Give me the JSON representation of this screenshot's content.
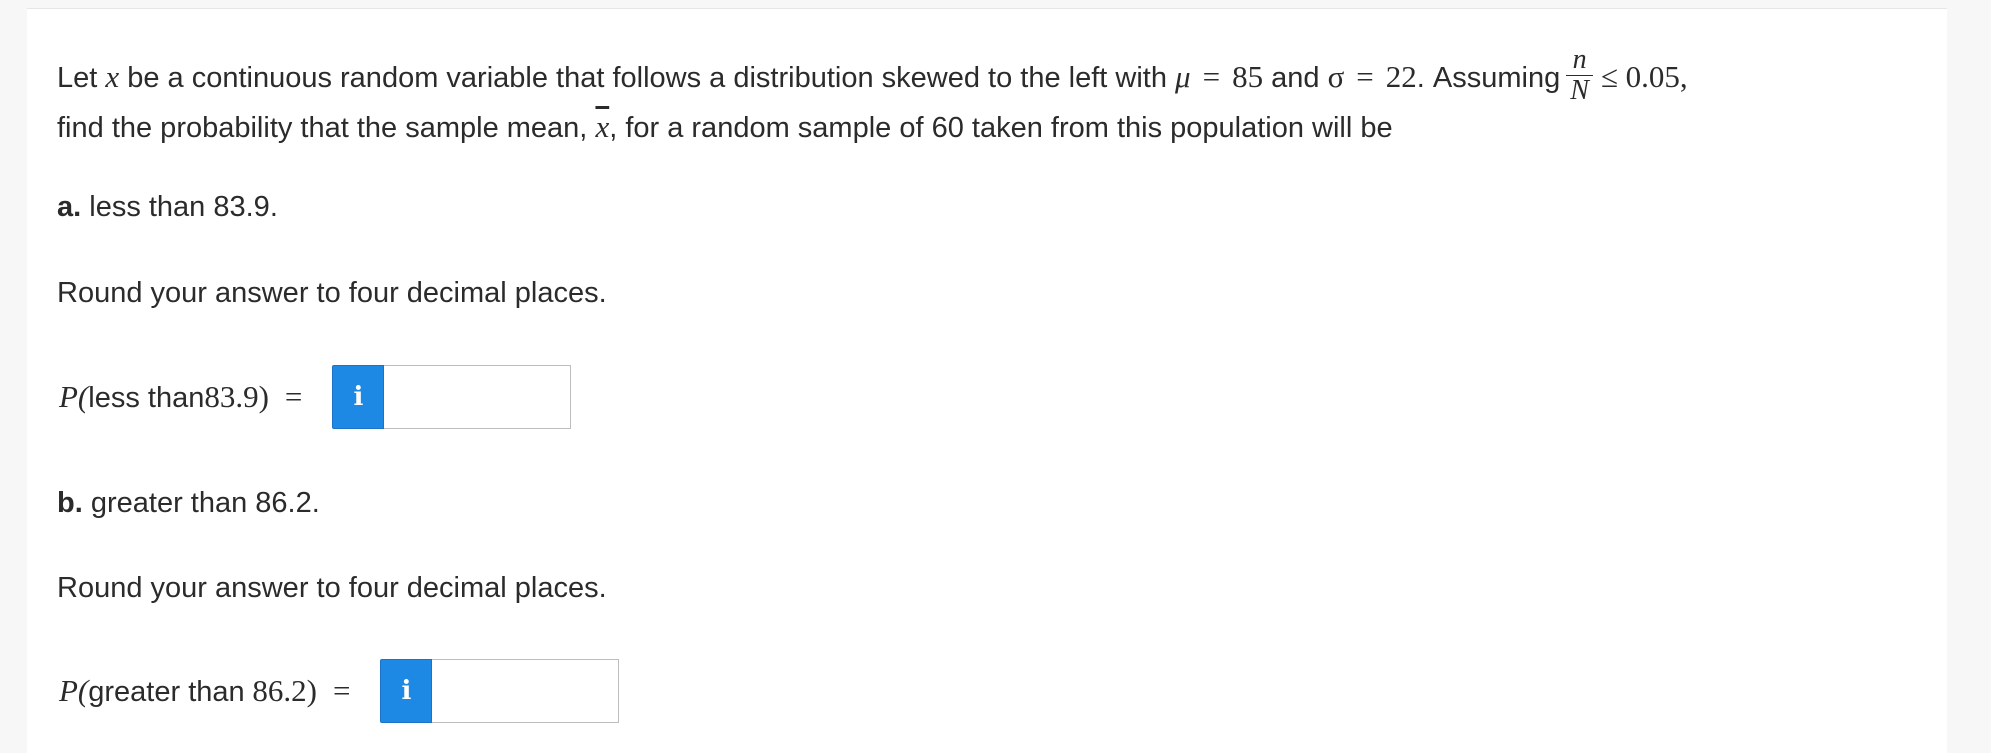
{
  "question": {
    "line1_start": "Let ",
    "var_x": "x",
    "line1_mid": " be a continuous random variable that follows a distribution skewed to the left with ",
    "mu": "μ",
    "eq": "=",
    "mu_value": "85",
    "and_word": " and ",
    "sigma": "σ",
    "sigma_value": "22",
    "assuming": ". Assuming",
    "frac_num": "n",
    "frac_den": "N",
    "leq_value": "≤ 0.05,",
    "line2_start": "find the probability that the sample mean, ",
    "xbar": "x",
    "line2_end": ", for a random sample of 60 taken from this population will be"
  },
  "part_a": {
    "letter": "a.",
    "text": " less than 83.9.",
    "instruction": "Round your answer to four decimal places.",
    "expr_p": "P(",
    "expr_word": "less than",
    "expr_value": "83.9)",
    "equals": "=",
    "info_icon": "i",
    "input_value": ""
  },
  "part_b": {
    "letter": "b.",
    "text": " greater than 86.2.",
    "instruction": "Round your answer to four decimal places.",
    "expr_p": "P(",
    "expr_word": "greater than",
    "expr_value": " 86.2)",
    "equals": "=",
    "info_icon": "i",
    "input_value": ""
  },
  "colors": {
    "info_button": "#1e88e5",
    "text": "#2b2b2b"
  }
}
